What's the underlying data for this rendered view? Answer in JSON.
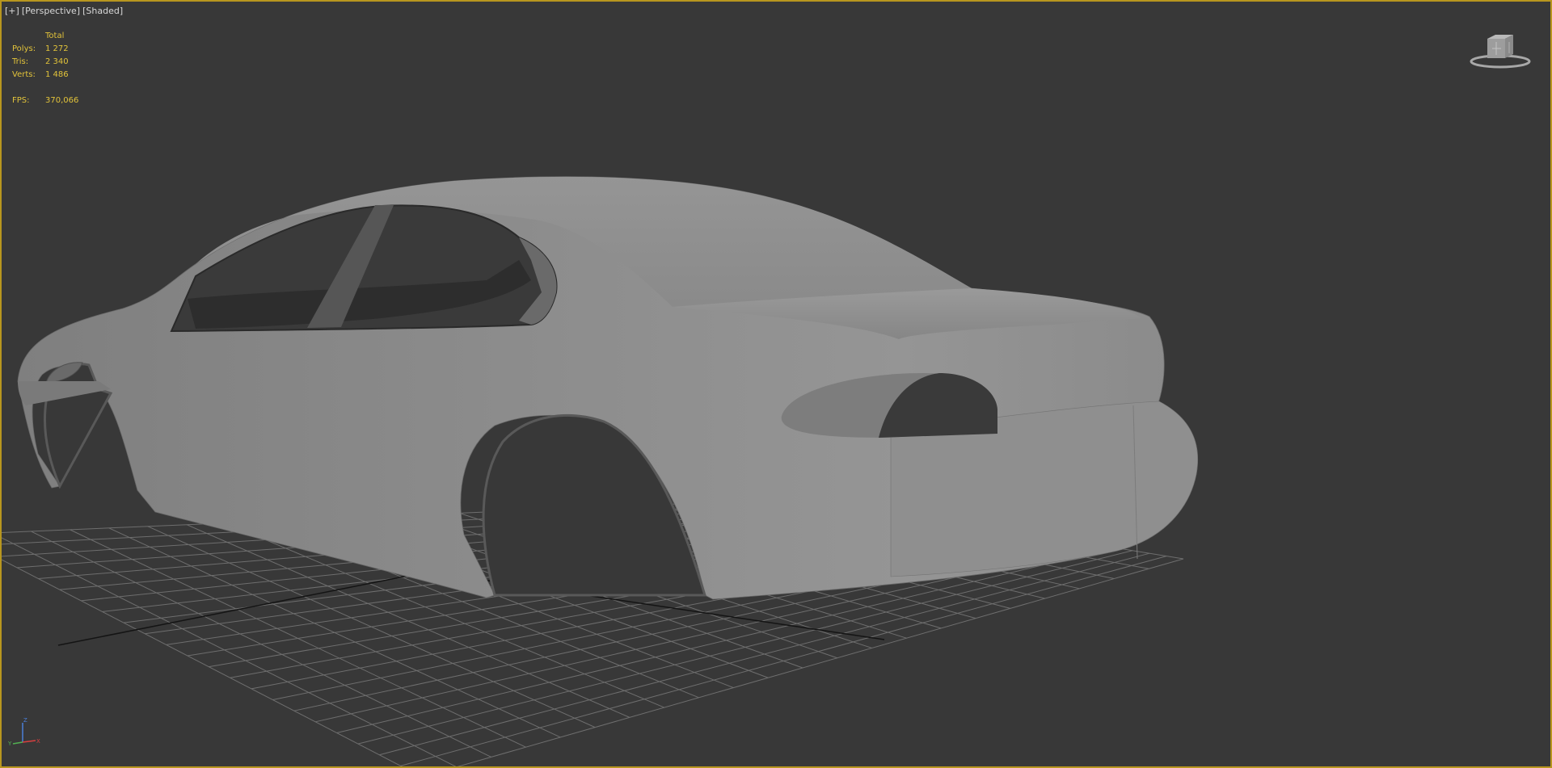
{
  "viewport": {
    "label_plus": "[+]",
    "label_view": "[Perspective]",
    "label_shading": "[Shaded]"
  },
  "stats": {
    "header": "Total",
    "rows": [
      {
        "key": "Polys:",
        "value": "1 272"
      },
      {
        "key": "Tris:",
        "value": "2 340"
      },
      {
        "key": "Verts:",
        "value": "1 486"
      }
    ],
    "fps_key": "FPS:",
    "fps_value": "370,066"
  },
  "colors": {
    "border_active": "#b8961e",
    "stats_text": "#e2c33a",
    "background": "#383838",
    "grid": "#6e6e6e",
    "grid_axis": "#141414",
    "model": "#8e8e8e"
  },
  "icons": {
    "viewcube": "viewcube-icon",
    "tripod": "axis-tripod-icon"
  },
  "axes": {
    "x": "X",
    "y": "Y",
    "z": "Z"
  }
}
